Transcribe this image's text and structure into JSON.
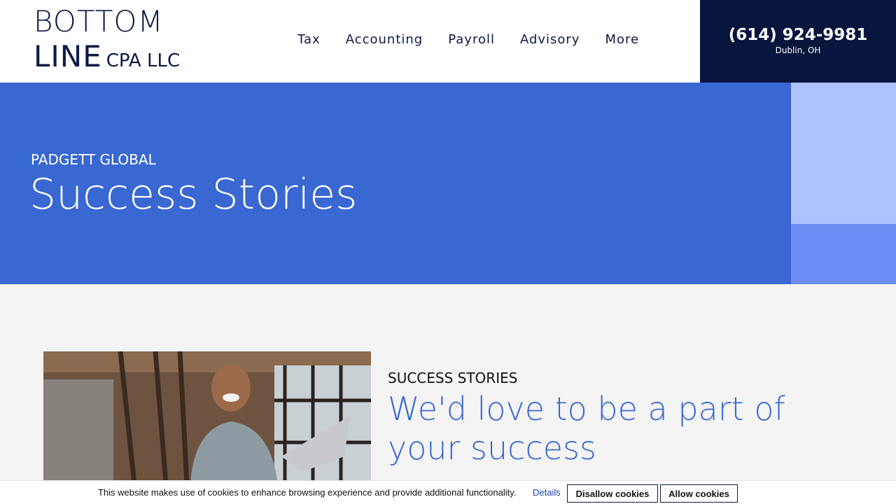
{
  "header": {
    "logo": {
      "line1": "BOTTOM",
      "line2_big": "LINE",
      "line2_small": "CPA LLC"
    },
    "nav": [
      "Tax",
      "Accounting",
      "Payroll",
      "Advisory",
      "More"
    ],
    "phone": "(614) 924-9981",
    "city": "Dublin, OH"
  },
  "hero": {
    "eyebrow": "PADGETT GLOBAL",
    "title": "Success Stories"
  },
  "content": {
    "eyebrow": "SUCCESS STORIES",
    "title": "We'd love to be a part of your success"
  },
  "cookie": {
    "text": "This website makes use of cookies to enhance browsing experience and provide additional functionality.",
    "details": "Details",
    "disallow": "Disallow cookies",
    "allow": "Allow cookies"
  },
  "colors": {
    "navy": "#08163e",
    "hero_blue": "#3968d2",
    "light_blue": "#aec3fb",
    "mid_blue": "#6b8cf5"
  }
}
